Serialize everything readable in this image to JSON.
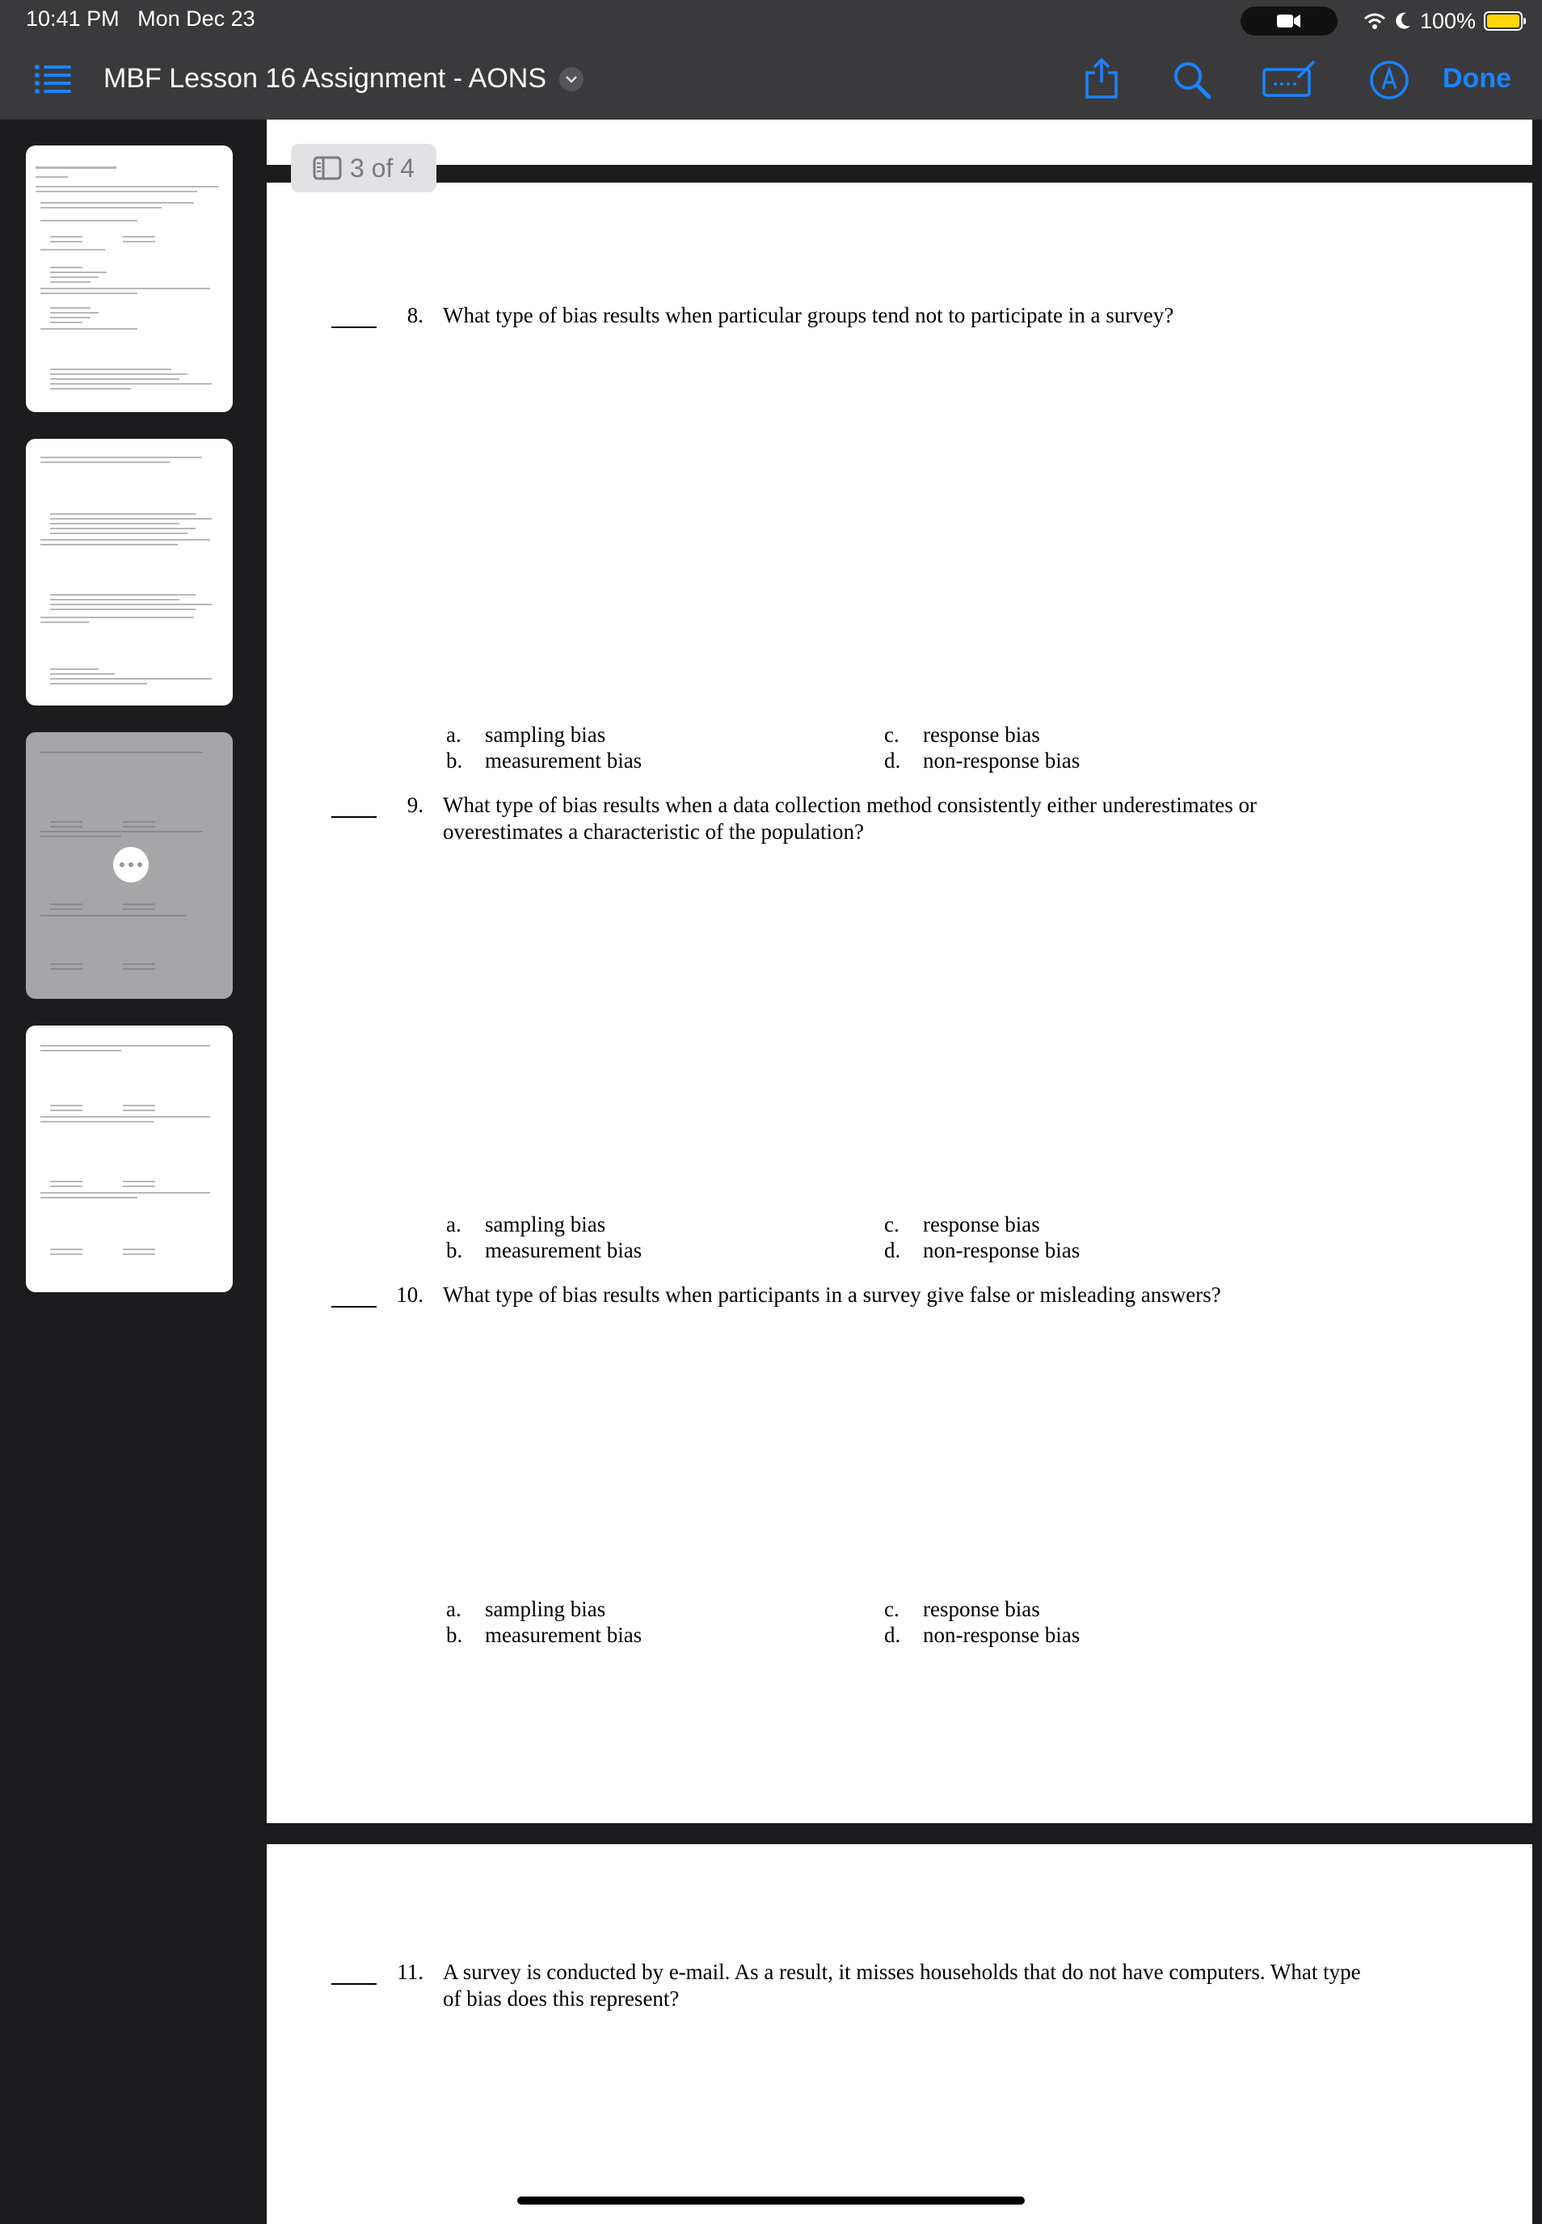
{
  "status": {
    "time": "10:41 PM",
    "date": "Mon Dec 23",
    "battery": "100%",
    "battery_level": 1.0
  },
  "nav": {
    "title": "MBF Lesson 16 Assignment - AONS",
    "done": "Done"
  },
  "page_indicator": "3 of 4",
  "questions": [
    {
      "num": "8.",
      "text": "What type of bias results when particular groups tend not to participate in a survey?",
      "options": [
        "sampling bias",
        "measurement bias",
        "response bias",
        "non-response bias"
      ]
    },
    {
      "num": "9.",
      "text": "What type of bias results when a data collection method consistently either underestimates or overestimates a characteristic of the population?",
      "options": [
        "sampling bias",
        "measurement bias",
        "response bias",
        "non-response bias"
      ]
    },
    {
      "num": "10.",
      "text": "What type of bias results when participants in a survey give false or misleading answers?",
      "options": [
        "sampling bias",
        "measurement bias",
        "response bias",
        "non-response bias"
      ]
    },
    {
      "num": "11.",
      "text": "A survey is conducted by e-mail. As a result, it misses households that do not have computers. What type of bias does this represent?"
    }
  ],
  "letters": [
    "a.",
    "b.",
    "c.",
    "d."
  ],
  "icons": {
    "list": "list-icon",
    "share": "share-icon",
    "search": "search-icon",
    "keyboard": "keyboard-icon",
    "markup": "markup-icon",
    "more": "more-icon"
  },
  "accent_color": "#1a84ff"
}
